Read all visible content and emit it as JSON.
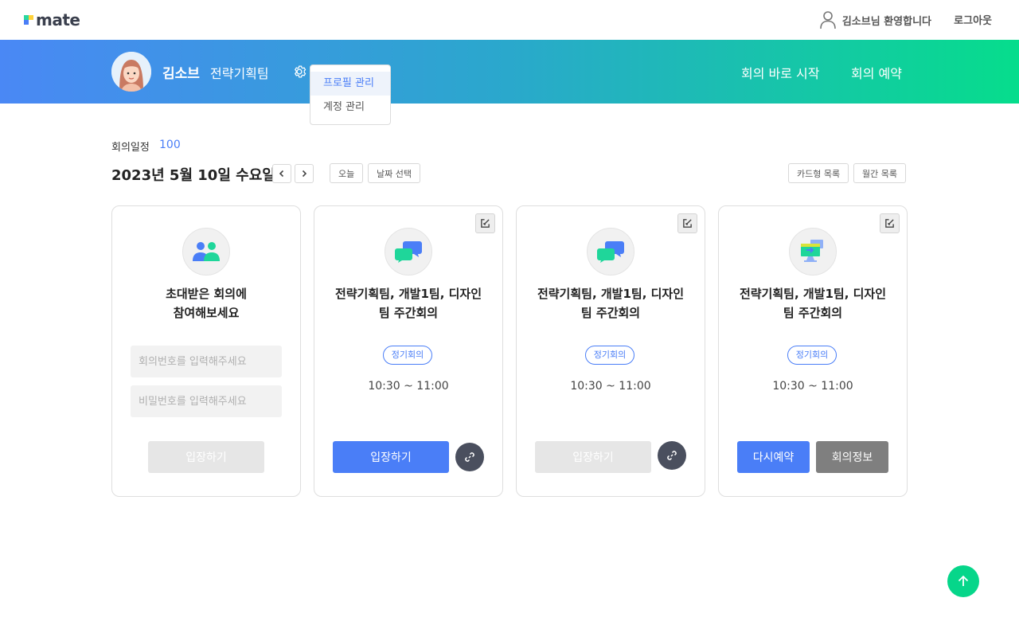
{
  "header": {
    "logo_text": "mate",
    "greeting": "김소브님 환영합니다",
    "logout_label": "로그아웃"
  },
  "banner": {
    "user_name": "김소브",
    "team": "전략기획팀",
    "start_meeting_label": "회의 바로 시작",
    "reserve_meeting_label": "회의 예약",
    "gradient_colors": [
      "#4a88f5",
      "#06dd8c"
    ]
  },
  "settings_menu": {
    "items": [
      "프로필 관리",
      "계정 관리"
    ],
    "active_index": 0
  },
  "schedule": {
    "label": "회의일정",
    "count": "100",
    "date": "2023년 5월 10일 수요일",
    "today_label": "오늘",
    "pick_date_label": "날짜 선택",
    "card_view_label": "카드형 목록",
    "month_view_label": "월간 목록"
  },
  "join_card": {
    "title": "초대받은 회의에\n참여해보세요",
    "number_placeholder": "회의번호를 입력해주세요",
    "password_placeholder": "비밀번호를 입력해주세요",
    "enter_label": "입장하기"
  },
  "meetings": [
    {
      "title": "전략기획팀, 개발1팀, 디자인팀 주간회의",
      "tag": "정기회의",
      "time": "10:30 ~ 11:00",
      "enter_label": "입장하기"
    },
    {
      "title": "전략기획팀, 개발1팀, 디자인팀 주간회의",
      "tag": "정기회의",
      "time": "10:30 ~ 11:00",
      "enter_label": "입장하기"
    },
    {
      "title": "전략기획팀, 개발1팀, 디자인팀 주간회의",
      "tag": "정기회의",
      "time": "10:30 ~ 11:00",
      "rebook_label": "다시예약",
      "info_label": "회의정보"
    }
  ],
  "colors": {
    "accent_blue": "#4a7ef7",
    "accent_green": "#06d68a",
    "disabled_gray": "#e6e6e6"
  },
  "icons": [
    "person-icon",
    "gear-icon",
    "chevron-left-icon",
    "chevron-right-icon",
    "edit-icon",
    "link-icon",
    "arrow-up-icon",
    "group-icon",
    "chat-bubbles-icon",
    "screen-share-icon"
  ]
}
